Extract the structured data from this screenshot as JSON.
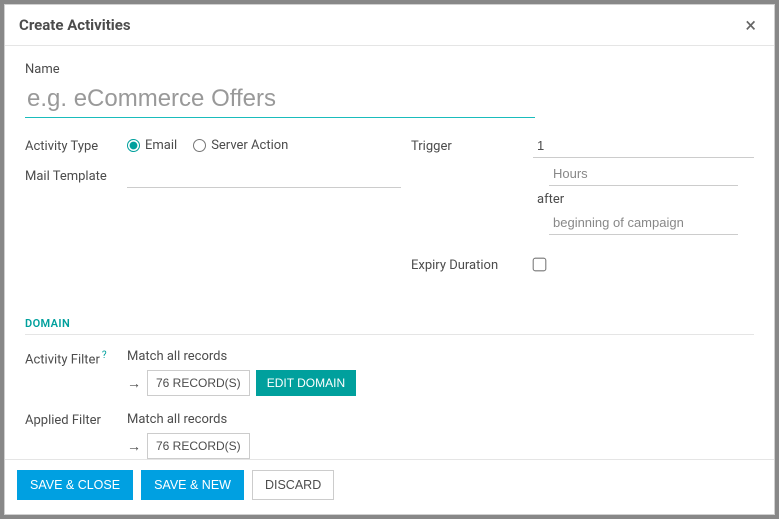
{
  "modal": {
    "title": "Create Activities",
    "close_aria": "Close"
  },
  "name": {
    "label": "Name",
    "value": "",
    "placeholder": "e.g. eCommerce Offers"
  },
  "activity_type": {
    "label": "Activity Type",
    "options": {
      "email": "Email",
      "server_action": "Server Action"
    },
    "selected": "email"
  },
  "mail_template": {
    "label": "Mail Template",
    "value": ""
  },
  "trigger": {
    "label": "Trigger",
    "amount": "1",
    "unit_placeholder": "Hours",
    "unit_value": "",
    "relation": "after",
    "event_placeholder": "beginning of campaign",
    "event_value": ""
  },
  "expiry": {
    "label": "Expiry Duration",
    "checked": false
  },
  "domain_section": {
    "title": "DOMAIN",
    "activity_filter": {
      "label": "Activity Filter",
      "match_text": "Match all records",
      "record_count": "76 RECORD(S)",
      "edit_label": "EDIT DOMAIN"
    },
    "applied_filter": {
      "label": "Applied Filter",
      "match_text": "Match all records",
      "record_count": "76 RECORD(S)"
    }
  },
  "footer": {
    "save_close": "SAVE & CLOSE",
    "save_new": "SAVE & NEW",
    "discard": "DISCARD"
  }
}
